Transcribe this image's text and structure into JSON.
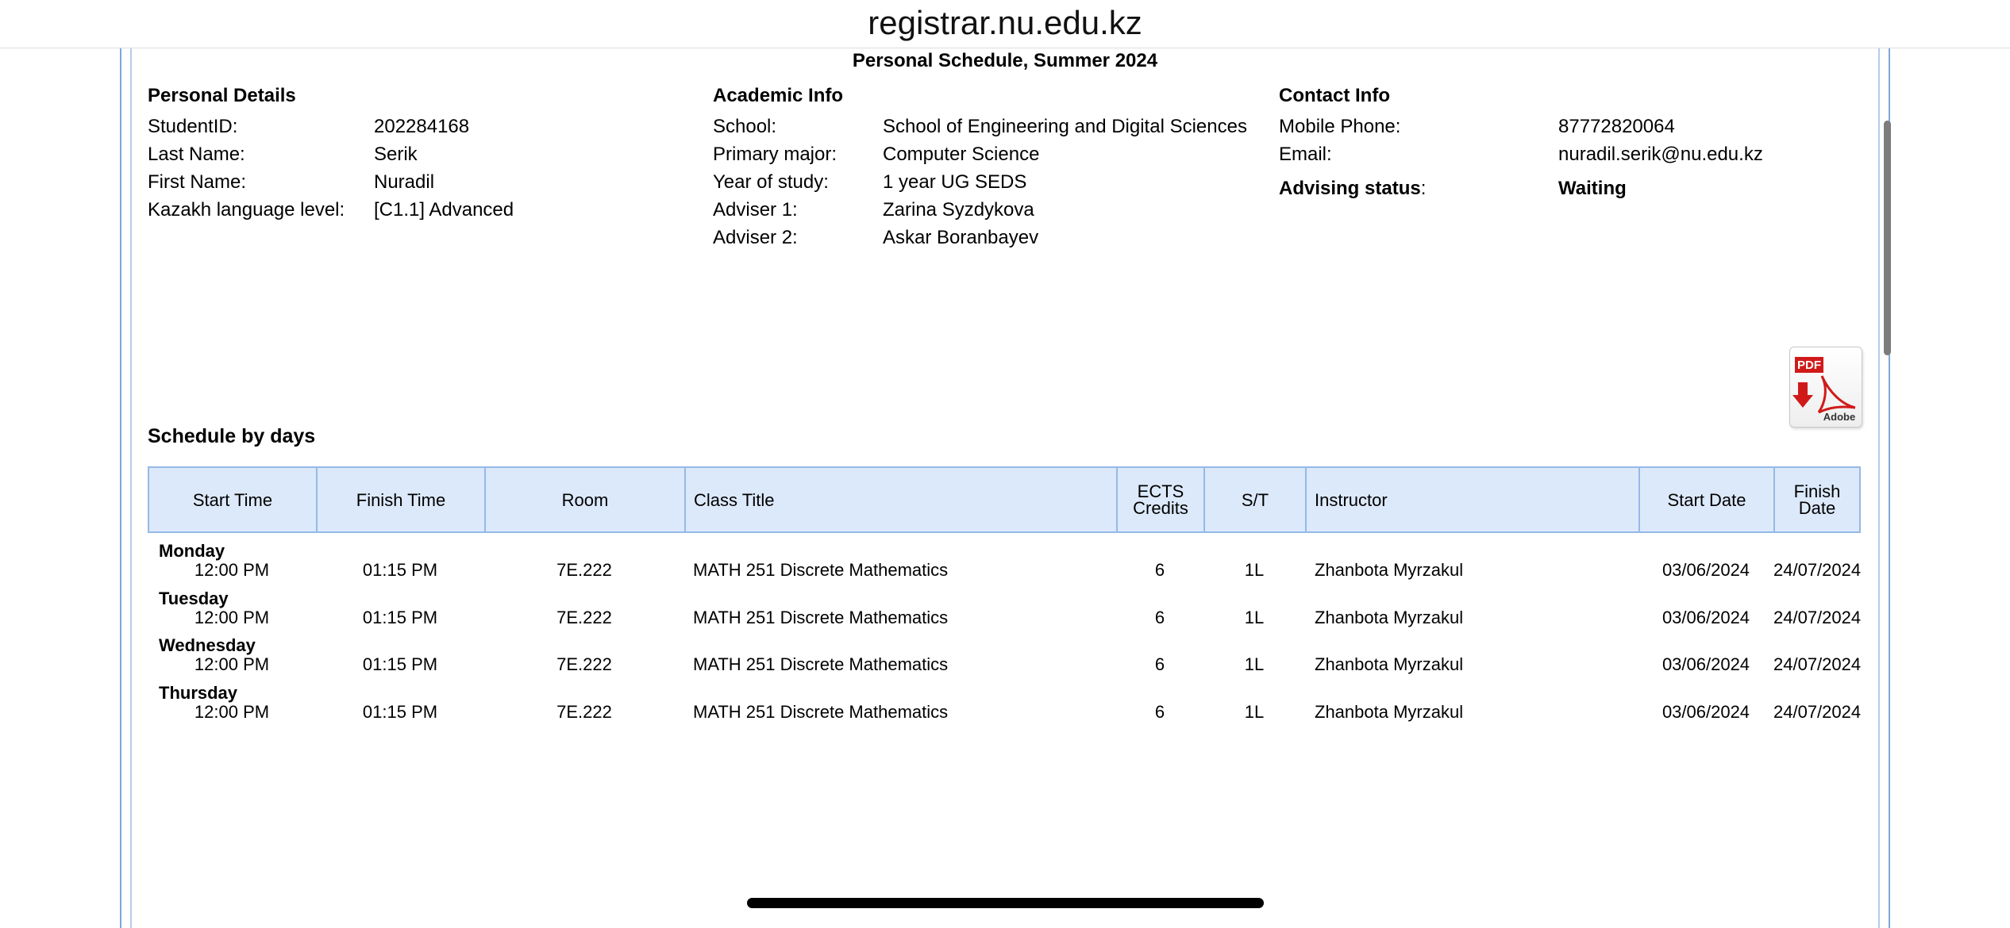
{
  "browser": {
    "url": "registrar.nu.edu.kz"
  },
  "page": {
    "title": "Personal Schedule, Summer 2024"
  },
  "personal_details": {
    "heading": "Personal Details",
    "rows": [
      {
        "label": "StudentID:",
        "value": "202284168"
      },
      {
        "label": "Last Name:",
        "value": "Serik"
      },
      {
        "label": "First Name:",
        "value": "Nuradil"
      },
      {
        "label": "Kazakh language level:",
        "value": "[C1.1] Advanced"
      }
    ]
  },
  "academic_info": {
    "heading": "Academic Info",
    "rows": [
      {
        "label": "School:",
        "value": "School of Engineering and Digital Sciences"
      },
      {
        "label": "Primary major:",
        "value": "Computer Science"
      },
      {
        "label": "Year of study:",
        "value": "1 year UG SEDS"
      },
      {
        "label": "Adviser 1:",
        "value": "Zarina Syzdykova"
      },
      {
        "label": "Adviser 2:",
        "value": "Askar Boranbayev"
      }
    ]
  },
  "contact_info": {
    "heading": "Contact Info",
    "rows": [
      {
        "label": "Mobile Phone:",
        "value": "87772820064"
      },
      {
        "label": "Email:",
        "value": "nuradil.serik@nu.edu.kz"
      }
    ],
    "advising": {
      "label": "Advising status",
      "colon": ":",
      "value": "Waiting"
    }
  },
  "pdf_button": {
    "icon": "pdf-adobe-icon",
    "badge": "PDF",
    "brand": "Adobe"
  },
  "schedule": {
    "heading": "Schedule by days",
    "columns": {
      "start_time": "Start Time",
      "finish_time": "Finish Time",
      "room": "Room",
      "class_title": "Class Title",
      "ects_line1": "ECTS",
      "ects_line2": "Credits",
      "st": "S/T",
      "instructor": "Instructor",
      "start_date": "Start Date",
      "finish_line1": "Finish",
      "finish_line2": "Date"
    },
    "days": [
      {
        "day": "Monday",
        "start": "12:00 PM",
        "finish": "01:15 PM",
        "room": "7E.222",
        "title": "MATH 251 Discrete Mathematics",
        "ects": "6",
        "st": "1L",
        "instructor": "Zhanbota Myrzakul",
        "start_date": "03/06/2024",
        "finish_date": "24/07/2024"
      },
      {
        "day": "Tuesday",
        "start": "12:00 PM",
        "finish": "01:15 PM",
        "room": "7E.222",
        "title": "MATH 251 Discrete Mathematics",
        "ects": "6",
        "st": "1L",
        "instructor": "Zhanbota Myrzakul",
        "start_date": "03/06/2024",
        "finish_date": "24/07/2024"
      },
      {
        "day": "Wednesday",
        "start": "12:00 PM",
        "finish": "01:15 PM",
        "room": "7E.222",
        "title": "MATH 251 Discrete Mathematics",
        "ects": "6",
        "st": "1L",
        "instructor": "Zhanbota Myrzakul",
        "start_date": "03/06/2024",
        "finish_date": "24/07/2024"
      },
      {
        "day": "Thursday",
        "start": "12:00 PM",
        "finish": "01:15 PM",
        "room": "7E.222",
        "title": "MATH 251 Discrete Mathematics",
        "ects": "6",
        "st": "1L",
        "instructor": "Zhanbota Myrzakul",
        "start_date": "03/06/2024",
        "finish_date": "24/07/2024"
      }
    ]
  },
  "colors": {
    "header_bg": "#dce9fa",
    "header_border": "#95b9e6",
    "frame": "#7fa7d8",
    "pdf_red": "#d01a1a"
  }
}
